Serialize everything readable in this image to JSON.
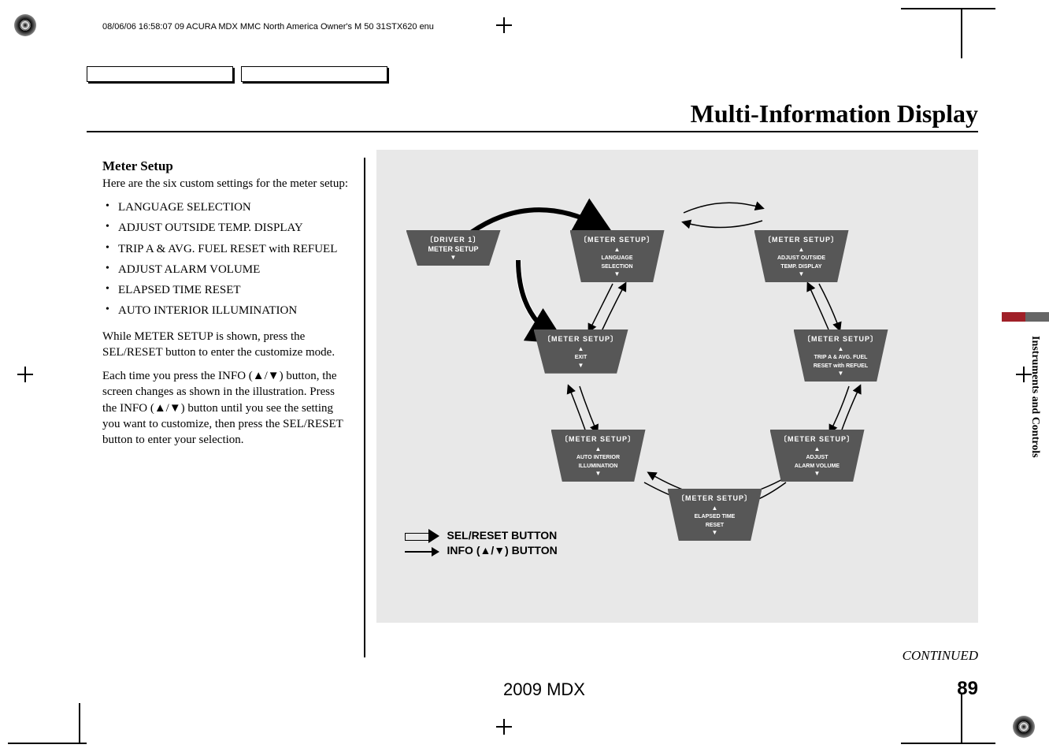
{
  "header": "08/06/06 16:58:07   09 ACURA MDX MMC North America Owner's M 50 31STX620 enu",
  "page_title": "Multi-Information Display",
  "section_name": "Instruments and Controls",
  "subhead": "Meter Setup",
  "intro": "Here are the six custom settings for the meter setup:",
  "list": [
    "LANGUAGE SELECTION",
    "ADJUST OUTSIDE TEMP. DISPLAY",
    "TRIP A & AVG. FUEL RESET with REFUEL",
    "ADJUST ALARM VOLUME",
    "ELAPSED TIME RESET",
    "AUTO INTERIOR ILLUMINATION"
  ],
  "para1": "While METER SETUP is shown, press the SEL/RESET button to enter the customize mode.",
  "para2": "Each time you press the INFO (▲/▼) button, the screen changes as shown in the illustration. Press the INFO (▲/▼) button until you see the setting you want to customize, then press the SEL/RESET button to enter your selection.",
  "diagram": {
    "driver": {
      "bracket": "〔DRIVER 1〕",
      "line": "METER SETUP"
    },
    "lang": {
      "bracket": "〔METER SETUP〕",
      "l1": "LANGUAGE",
      "l2": "SELECTION"
    },
    "temp": {
      "bracket": "〔METER SETUP〕",
      "l1": "ADJUST OUTSIDE",
      "l2": "TEMP. DISPLAY"
    },
    "exit": {
      "bracket": "〔METER SETUP〕",
      "l1": "EXIT"
    },
    "fuel": {
      "bracket": "〔METER SETUP〕",
      "l1": "TRIP A & AVG. FUEL",
      "l2": "RESET with REFUEL"
    },
    "auto": {
      "bracket": "〔METER SETUP〕",
      "l1": "AUTO INTERIOR",
      "l2": "ILLUMINATION"
    },
    "vol": {
      "bracket": "〔METER SETUP〕",
      "l1": "ADJUST",
      "l2": "ALARM VOLUME"
    },
    "time": {
      "bracket": "〔METER SETUP〕",
      "l1": "ELAPSED TIME",
      "l2": "RESET"
    }
  },
  "legend": {
    "sel": "SEL/RESET BUTTON",
    "info": "INFO (▲/▼) BUTTON"
  },
  "continued": "CONTINUED",
  "footer_model": "2009  MDX",
  "page_num": "89",
  "chart_data": {
    "type": "diagram",
    "description": "Meter Setup navigation flow",
    "start_node": "DRIVER 1 / METER SETUP",
    "enter_action": "SEL/RESET BUTTON",
    "cycle_action": "INFO (▲/▼) BUTTON",
    "cycle_nodes_clockwise": [
      "LANGUAGE SELECTION",
      "ADJUST OUTSIDE TEMP. DISPLAY",
      "TRIP A & AVG. FUEL RESET with REFUEL",
      "ADJUST ALARM VOLUME",
      "ELAPSED TIME RESET",
      "AUTO INTERIOR ILLUMINATION",
      "EXIT"
    ]
  }
}
